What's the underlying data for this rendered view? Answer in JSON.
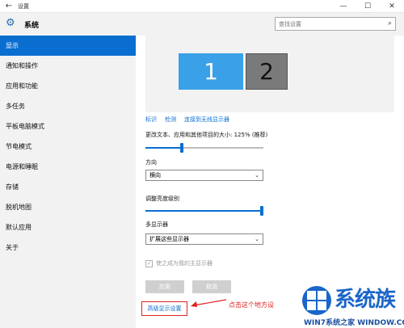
{
  "titlebar": {
    "back_icon": "back-arrow-icon",
    "title": "设置",
    "controls": [
      "—",
      "☐",
      "✕"
    ]
  },
  "header": {
    "icon": "gear-icon",
    "title": "系统",
    "search_placeholder": "查找设置"
  },
  "sidebar": {
    "items": [
      {
        "label": "显示",
        "active": true
      },
      {
        "label": "通知和操作"
      },
      {
        "label": "应用和功能"
      },
      {
        "label": "多任务"
      },
      {
        "label": "平板电脑模式"
      },
      {
        "label": "节电模式"
      },
      {
        "label": "电源和睡眠"
      },
      {
        "label": "存储"
      },
      {
        "label": "脱机地图"
      },
      {
        "label": "默认应用"
      },
      {
        "label": "关于"
      }
    ]
  },
  "main": {
    "monitors": [
      "1",
      "2"
    ],
    "links": {
      "identify": "标识",
      "detect": "检测",
      "connect": "连接到无线显示器"
    },
    "scale": {
      "label": "更改文本、应用和其他项目的大小: 125% (推荐)",
      "value_fraction": 0.3
    },
    "orientation": {
      "label": "方向",
      "value": "横向"
    },
    "brightness": {
      "label": "调整亮度级别",
      "value_fraction": 1.0
    },
    "multi_display": {
      "label": "多显示器",
      "value": "扩展这些显示器"
    },
    "main_display_checkbox": {
      "label": "使之成为我的主显示器",
      "checked": true,
      "disabled": true
    },
    "apply_button": "应用",
    "cancel_button": "取消",
    "advanced_link": "高级显示设置",
    "annotation": "点击这个地方设",
    "accent_color": "#0a6ed1",
    "annotation_color": "#e02020"
  },
  "watermark": {
    "brand": "系统族",
    "url": "WIN7系统之家 WINDOW.COM"
  }
}
